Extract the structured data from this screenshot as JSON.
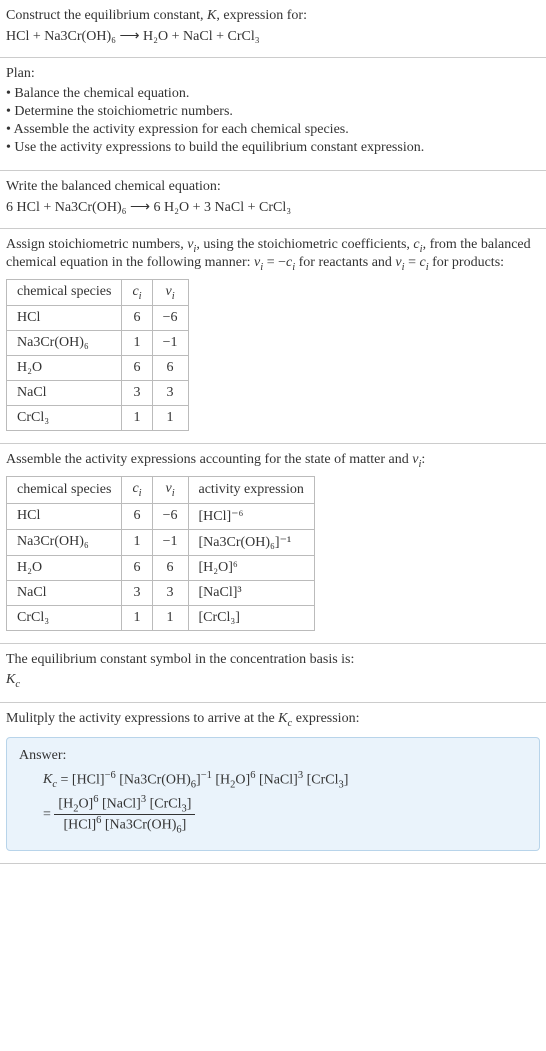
{
  "intro": {
    "line1": "Construct the equilibrium constant, K, expression for:",
    "eq": "HCl + Na3Cr(OH)₆ ⟶ H₂O + NaCl + CrCl₃"
  },
  "plan": {
    "title": "Plan:",
    "items": [
      "• Balance the chemical equation.",
      "• Determine the stoichiometric numbers.",
      "• Assemble the activity expression for each chemical species.",
      "• Use the activity expressions to build the equilibrium constant expression."
    ]
  },
  "balanced": {
    "line1": "Write the balanced chemical equation:",
    "eq": "6 HCl + Na3Cr(OH)₆ ⟶ 6 H₂O + 3 NaCl + CrCl₃"
  },
  "stoich": {
    "intro": "Assign stoichiometric numbers, νᵢ, using the stoichiometric coefficients, cᵢ, from the balanced chemical equation in the following manner: νᵢ = −cᵢ for reactants and νᵢ = cᵢ for products:",
    "headers": [
      "chemical species",
      "cᵢ",
      "νᵢ"
    ],
    "rows": [
      {
        "sp": "HCl",
        "c": "6",
        "v": "−6"
      },
      {
        "sp": "Na3Cr(OH)₆",
        "c": "1",
        "v": "−1"
      },
      {
        "sp": "H₂O",
        "c": "6",
        "v": "6"
      },
      {
        "sp": "NaCl",
        "c": "3",
        "v": "3"
      },
      {
        "sp": "CrCl₃",
        "c": "1",
        "v": "1"
      }
    ]
  },
  "activity": {
    "intro": "Assemble the activity expressions accounting for the state of matter and νᵢ:",
    "headers": [
      "chemical species",
      "cᵢ",
      "νᵢ",
      "activity expression"
    ],
    "rows": [
      {
        "sp": "HCl",
        "c": "6",
        "v": "−6",
        "a": "[HCl]⁻⁶"
      },
      {
        "sp": "Na3Cr(OH)₆",
        "c": "1",
        "v": "−1",
        "a": "[Na3Cr(OH)₆]⁻¹"
      },
      {
        "sp": "H₂O",
        "c": "6",
        "v": "6",
        "a": "[H₂O]⁶"
      },
      {
        "sp": "NaCl",
        "c": "3",
        "v": "3",
        "a": "[NaCl]³"
      },
      {
        "sp": "CrCl₃",
        "c": "1",
        "v": "1",
        "a": "[CrCl₃]"
      }
    ]
  },
  "symbol": {
    "line1": "The equilibrium constant symbol in the concentration basis is:",
    "kc": "K_c"
  },
  "multiply": {
    "line1": "Mulitply the activity expressions to arrive at the K_c expression:"
  },
  "answer": {
    "label": "Answer:",
    "line1": "K_c = [HCl]⁻⁶ [Na3Cr(OH)₆]⁻¹ [H₂O]⁶ [NaCl]³ [CrCl₃]",
    "eq": "=",
    "num": "[H₂O]⁶ [NaCl]³ [CrCl₃]",
    "den": "[HCl]⁶ [Na3Cr(OH)₆]"
  }
}
